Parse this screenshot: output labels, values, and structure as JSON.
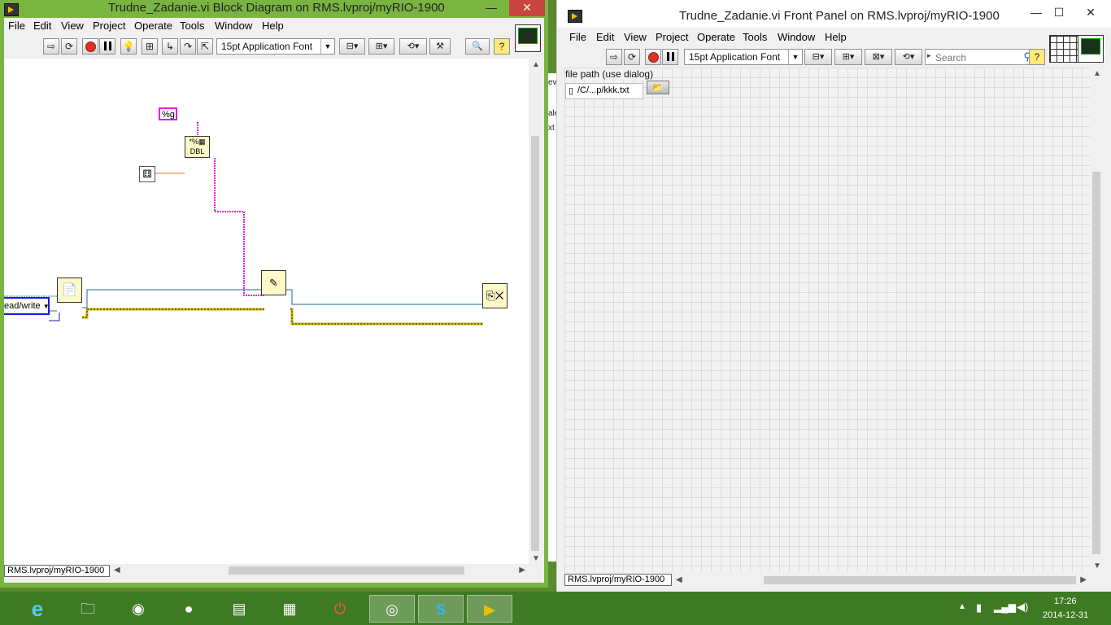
{
  "block_diagram": {
    "title": "Trudne_Zadanie.vi Block Diagram on RMS.lvproj/myRIO-1900",
    "menu": [
      "File",
      "Edit",
      "View",
      "Project",
      "Operate",
      "Tools",
      "Window",
      "Help"
    ],
    "font_selector": "15pt Application Font",
    "format_constant": "%g",
    "enum_constant": "ead/write",
    "project_target": "RMS.lvproj/myRIO-1900",
    "minimize": "—",
    "close": "✕"
  },
  "front_panel": {
    "title": "Trudne_Zadanie.vi Front Panel on RMS.lvproj/myRIO-1900",
    "menu": [
      "File",
      "Edit",
      "View",
      "Project",
      "Operate",
      "Tools",
      "Window",
      "Help"
    ],
    "font_selector": "15pt Application Font",
    "search_placeholder": "Search",
    "control_label": "file path (use dialog)",
    "control_value": "/C/...p/kkk.txt",
    "project_target": "RMS.lvproj/myRIO-1900",
    "minimize": "—",
    "maximize": "☐",
    "close": "✕"
  },
  "behind_window_fragments": [
    "ev",
    "ale",
    "xt"
  ],
  "taskbar": {
    "time": "17:26",
    "date": "2014-12-31"
  },
  "colors": {
    "bd_frame": "#79b540",
    "fp_grid": "#dcdcdc",
    "string_wire": "#e01ee0",
    "refnum_wire": "#1a6e8a",
    "error_wire": "#c8b400",
    "taskbar": "#3e7a23"
  }
}
